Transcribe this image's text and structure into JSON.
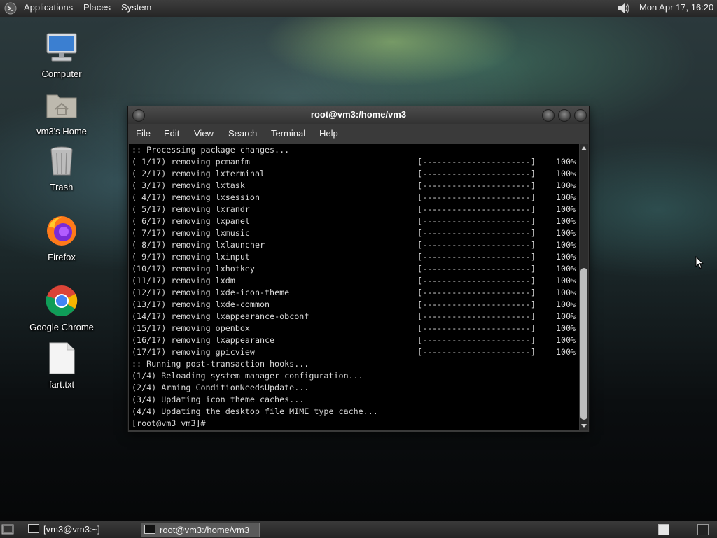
{
  "top_panel": {
    "menus": [
      "Applications",
      "Places",
      "System"
    ],
    "clock": "Mon Apr 17, 16:20"
  },
  "desktop_icons": [
    {
      "label": "Computer",
      "icon": "computer-icon"
    },
    {
      "label": "vm3's Home",
      "icon": "home-folder-icon"
    },
    {
      "label": "Trash",
      "icon": "trash-icon"
    },
    {
      "label": "Firefox",
      "icon": "firefox-icon"
    },
    {
      "label": "Google Chrome",
      "icon": "chrome-icon"
    },
    {
      "label": "fart.txt",
      "icon": "text-file-icon"
    }
  ],
  "window": {
    "title": "root@vm3:/home/vm3",
    "menus": [
      "File",
      "Edit",
      "View",
      "Search",
      "Terminal",
      "Help"
    ]
  },
  "terminal": {
    "header": ":: Processing package changes...",
    "progress_bar": "[----------------------]",
    "removals": [
      {
        "step": "( 1/17)",
        "package": "pcmanfm",
        "percent": "100%"
      },
      {
        "step": "( 2/17)",
        "package": "lxterminal",
        "percent": "100%"
      },
      {
        "step": "( 3/17)",
        "package": "lxtask",
        "percent": "100%"
      },
      {
        "step": "( 4/17)",
        "package": "lxsession",
        "percent": "100%"
      },
      {
        "step": "( 5/17)",
        "package": "lxrandr",
        "percent": "100%"
      },
      {
        "step": "( 6/17)",
        "package": "lxpanel",
        "percent": "100%"
      },
      {
        "step": "( 7/17)",
        "package": "lxmusic",
        "percent": "100%"
      },
      {
        "step": "( 8/17)",
        "package": "lxlauncher",
        "percent": "100%"
      },
      {
        "step": "( 9/17)",
        "package": "lxinput",
        "percent": "100%"
      },
      {
        "step": "(10/17)",
        "package": "lxhotkey",
        "percent": "100%"
      },
      {
        "step": "(11/17)",
        "package": "lxdm",
        "percent": "100%"
      },
      {
        "step": "(12/17)",
        "package": "lxde-icon-theme",
        "percent": "100%"
      },
      {
        "step": "(13/17)",
        "package": "lxde-common",
        "percent": "100%"
      },
      {
        "step": "(14/17)",
        "package": "lxappearance-obconf",
        "percent": "100%"
      },
      {
        "step": "(15/17)",
        "package": "openbox",
        "percent": "100%"
      },
      {
        "step": "(16/17)",
        "package": "lxappearance",
        "percent": "100%"
      },
      {
        "step": "(17/17)",
        "package": "gpicview",
        "percent": "100%"
      }
    ],
    "verb": "removing",
    "post_lines": [
      ":: Running post-transaction hooks...",
      "(1/4) Reloading system manager configuration...",
      "(2/4) Arming ConditionNeedsUpdate...",
      "(3/4) Updating icon theme caches...",
      "(4/4) Updating the desktop file MIME type cache...",
      "[root@vm3 vm3]#"
    ]
  },
  "bottom_panel": {
    "tasks": [
      {
        "label": "[vm3@vm3:~]",
        "active": false
      },
      {
        "label": "root@vm3:/home/vm3",
        "active": true
      }
    ],
    "workspaces": 2,
    "current_workspace": 1
  }
}
